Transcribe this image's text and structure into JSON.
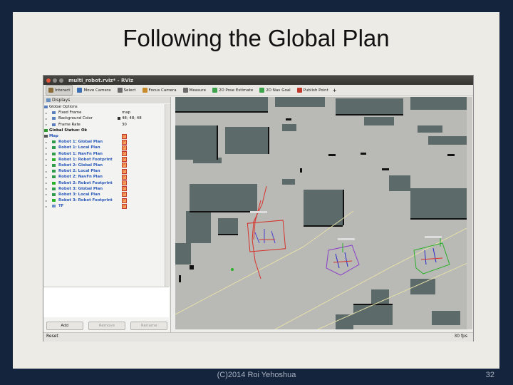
{
  "slide": {
    "title": "Following the Global Plan",
    "footer": "(C)2014 Roi Yehoshua",
    "page_number": "32"
  },
  "window": {
    "title": "multi_robot.rviz* - RViz"
  },
  "toolbar": {
    "items": [
      {
        "label": "Interact",
        "icon": "interact-icon",
        "active": true
      },
      {
        "label": "Move Camera",
        "icon": "move-camera-icon"
      },
      {
        "label": "Select",
        "icon": "select-icon"
      },
      {
        "label": "Focus Camera",
        "icon": "focus-camera-icon"
      },
      {
        "label": "Measure",
        "icon": "measure-icon"
      },
      {
        "label": "2D Pose Estimate",
        "icon": "pose-estimate-icon"
      },
      {
        "label": "2D Nav Goal",
        "icon": "nav-goal-icon"
      },
      {
        "label": "Publish Point",
        "icon": "publish-point-icon"
      }
    ]
  },
  "displays": {
    "title": "Displays",
    "items": [
      {
        "label": "Global Options",
        "top": true
      },
      {
        "label": "Fixed Frame",
        "value": "map"
      },
      {
        "label": "Background Color",
        "value": "48; 48; 48"
      },
      {
        "label": "Frame Rate",
        "value": "30"
      },
      {
        "label": "Global Status: Ok",
        "top": true
      },
      {
        "label": "Map",
        "top": true
      },
      {
        "label": "Robot 1: Global Plan"
      },
      {
        "label": "Robot 1: Local Plan"
      },
      {
        "label": "Robot 1: NavFn Plan"
      },
      {
        "label": "Robot 1: Robot Footprint"
      },
      {
        "label": "Robot 2: Global Plan"
      },
      {
        "label": "Robot 2: Local Plan"
      },
      {
        "label": "Robot 2: NavFn Plan"
      },
      {
        "label": "Robot 2: Robot Footprint"
      },
      {
        "label": "Robot 3: Global Plan"
      },
      {
        "label": "Robot 3: Local Plan"
      },
      {
        "label": "Robot 3: Robot Footprint"
      },
      {
        "label": "TF"
      }
    ],
    "buttons": {
      "add": "Add",
      "remove": "Remove",
      "rename": "Rename"
    }
  },
  "status": {
    "reset": "Reset",
    "fps": "30 fps"
  },
  "colors": {
    "slide_background": "#ecebe6",
    "frame": "#14243c",
    "map_free": "#b9b9b6",
    "map_obstacle": "#5d6a6a",
    "map_wall": "#111111",
    "robot1_footprint": "#d6332b",
    "robot2_footprint": "#8a3fc8",
    "robot3_footprint": "#29b12a",
    "plan_line": "#e4e0a8"
  }
}
